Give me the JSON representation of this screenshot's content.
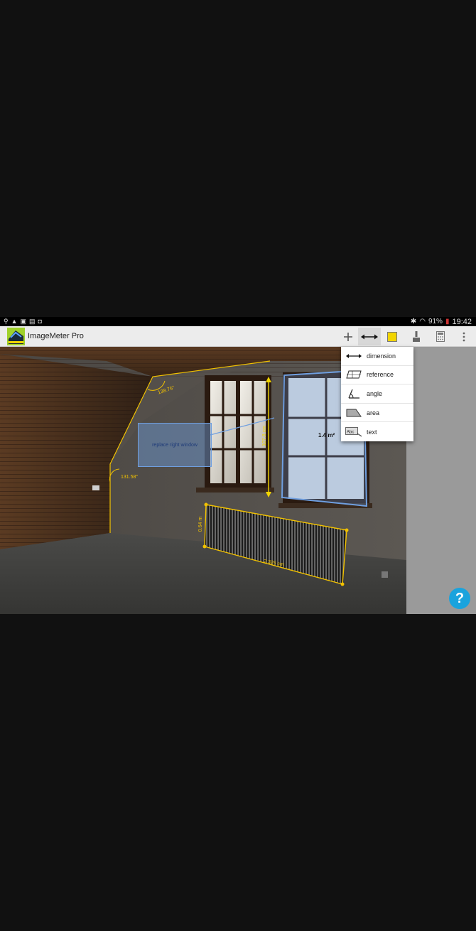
{
  "status_bar": {
    "battery": "91%",
    "time": "19:42"
  },
  "app": {
    "title": "ImageMeter Pro"
  },
  "toolbar": {
    "accent_color": "#f2d500",
    "buttons": [
      "plus-icon",
      "dimension-arrow-icon",
      "color-swatch",
      "brush-icon",
      "calculator-icon",
      "overflow-menu-icon"
    ]
  },
  "menu": {
    "items": [
      {
        "icon": "dimension-icon",
        "label": "dimension"
      },
      {
        "icon": "reference-icon",
        "label": "reference"
      },
      {
        "icon": "angle-icon",
        "label": "angle"
      },
      {
        "icon": "area-icon",
        "label": "area"
      },
      {
        "icon": "text-icon",
        "label": "text"
      }
    ]
  },
  "annotations": {
    "angle_top": "138.75°",
    "angle_left": "131.58°",
    "window_height": "107.8 cm",
    "area": "1.4 m²",
    "note": "replace right window",
    "radiator_height": "0.64 m",
    "radiator_width": "2.325 cm"
  },
  "colors": {
    "measure": "#f2c200",
    "reference": "#6f9fe0",
    "help": "#1aa3dd"
  }
}
